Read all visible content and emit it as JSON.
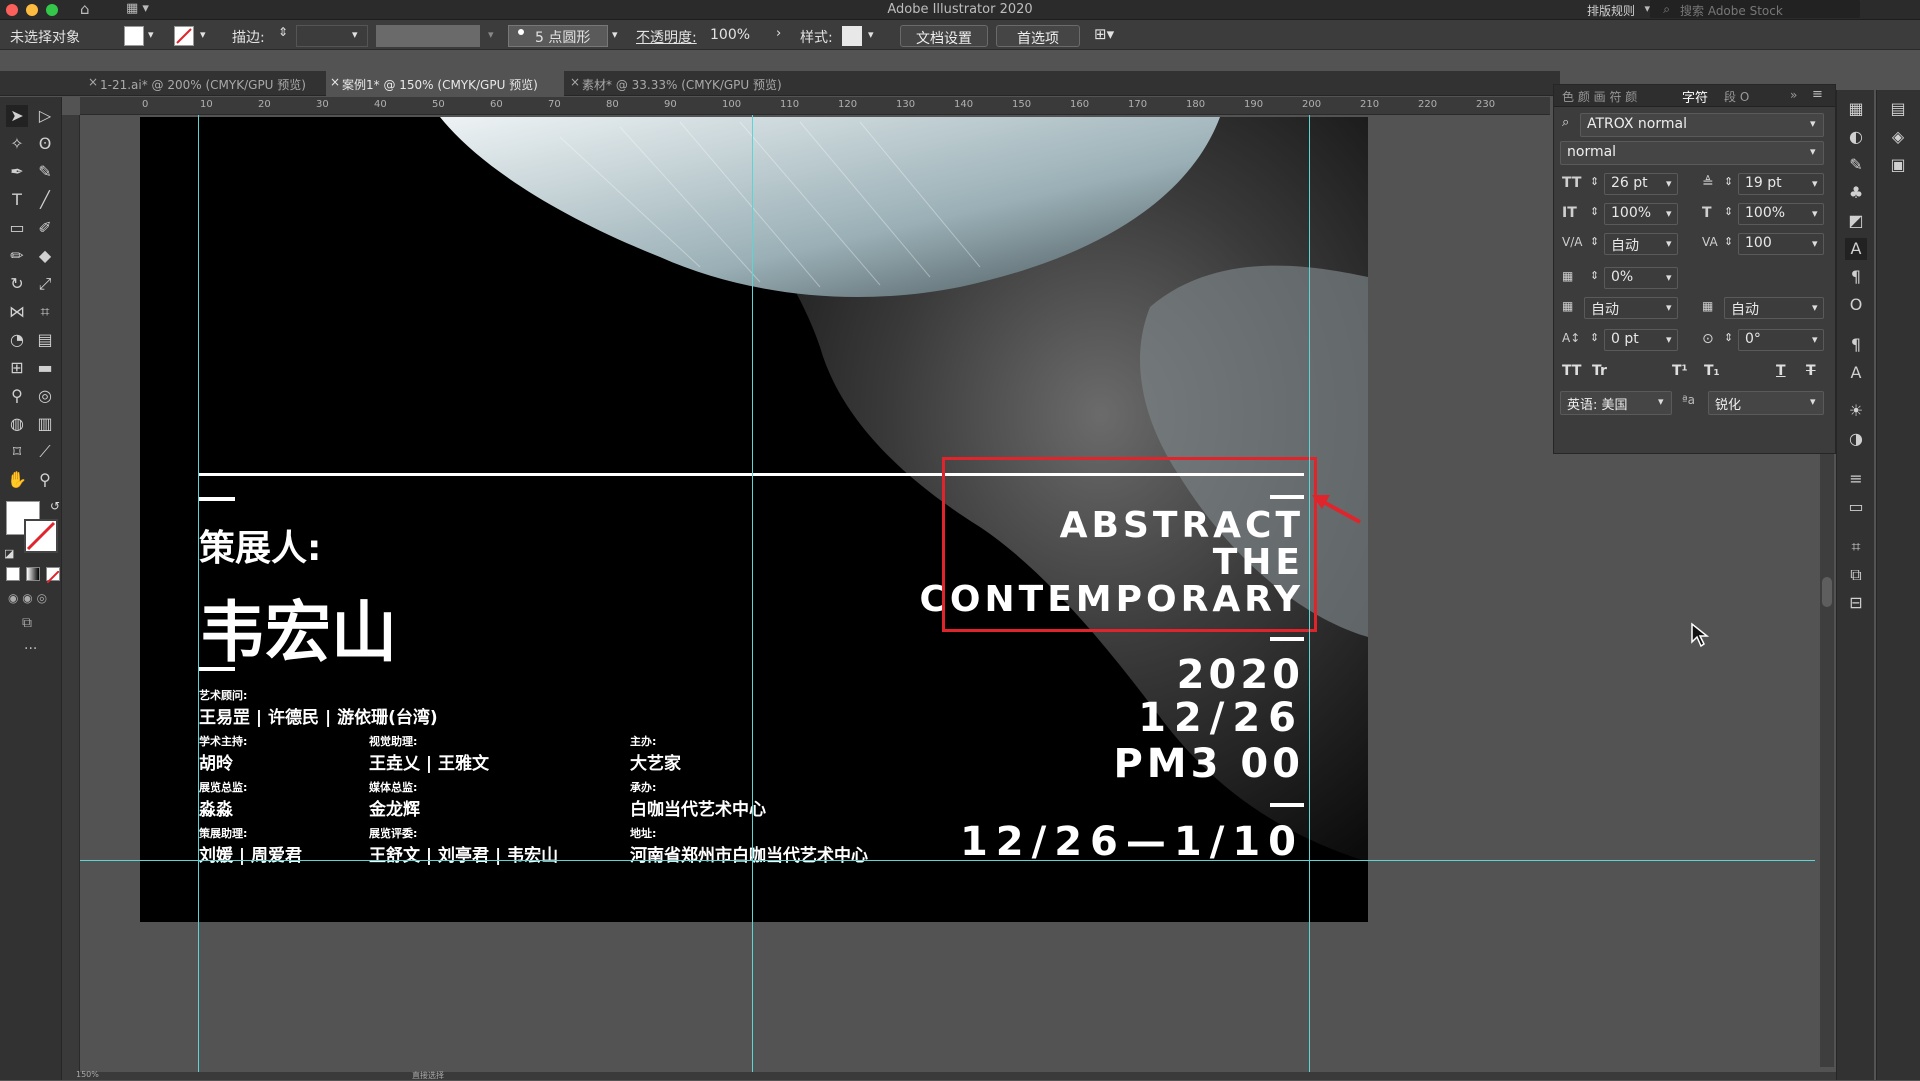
{
  "app": {
    "title": "Adobe Illustrator 2020",
    "workspace": "排版规则",
    "stock_search_placeholder": "搜索 Adobe Stock"
  },
  "control_bar": {
    "selection": "未选择对象",
    "stroke_label": "描边:",
    "brush": "5 点圆形",
    "opacity_label": "不透明度:",
    "opacity_value": "100%",
    "style_label": "样式:",
    "doc_setup": "文档设置",
    "preferences": "首选项"
  },
  "tabs": [
    {
      "label": "1-21.ai* @ 200% (CMYK/GPU 预览)",
      "active": false
    },
    {
      "label": "案例1* @ 150% (CMYK/GPU 预览)",
      "active": true
    },
    {
      "label": "素材* @ 33.33% (CMYK/GPU 预览)",
      "active": false
    }
  ],
  "ruler_ticks": [
    "0",
    "10",
    "20",
    "30",
    "40",
    "50",
    "60",
    "70",
    "80",
    "90",
    "100",
    "110",
    "120",
    "130",
    "140",
    "150",
    "160",
    "170",
    "180",
    "190",
    "200",
    "210",
    "220",
    "230"
  ],
  "poster": {
    "curator_label": "策展人:",
    "curator_name": "韦宏山",
    "title_line1": "ABSTRACT",
    "title_line2": "THE",
    "title_line3": "CONTEMPORARY",
    "year": "2020",
    "date": "12/26",
    "time": "PM3 00",
    "range": "12/26—1/10",
    "art_advisor_label": "艺术顾问:",
    "art_advisor_names": "王易罡 | 许德民 | 游依珊(台湾)",
    "academic_label": "学术主持:",
    "academic_name": "胡昤",
    "visual_label": "视觉助理:",
    "visual_names": "王垚乂 | 王雅文",
    "host_label": "主办:",
    "host_name": "大艺家",
    "exhibit_director_label": "展览总监:",
    "exhibit_director_name": "淼淼",
    "media_label": "媒体总监:",
    "media_name": "金龙辉",
    "organizer_label": "承办:",
    "organizer_name": "白咖当代艺术中心",
    "curator_asst_label": "策展助理:",
    "curator_asst_names": "刘媛 | 周爱君",
    "review_label": "展览评委:",
    "review_names": "王舒文 | 刘亭君 | 韦宏山",
    "address_label": "地址:",
    "address": "河南省郑州市白咖当代艺术中心"
  },
  "character_panel": {
    "tab_label": "字符",
    "font_family": "ATROX normal",
    "font_style": "normal",
    "font_size": "26 pt",
    "leading": "19 pt",
    "vertical_scale": "100%",
    "horizontal_scale": "100%",
    "kerning": "自动",
    "tracking": "100",
    "tsume": "0%",
    "aki_left": "自动",
    "aki_right": "自动",
    "baseline_shift": "0 pt",
    "rotation": "0°",
    "language": "英语: 美国",
    "antialias": "锐化",
    "aa_label": "a"
  },
  "status": {
    "zoom": "150%",
    "tool": "直接选择"
  },
  "colors": {
    "accent_guide": "#5fd4d4",
    "highlight_box": "#e0242b"
  }
}
